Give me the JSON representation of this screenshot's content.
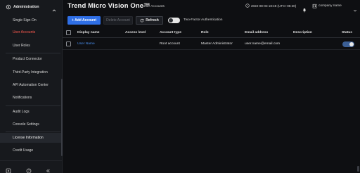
{
  "sidebar": {
    "header_label": "Administration",
    "items": [
      {
        "label": "Single Sign-On"
      },
      {
        "label": "User Accounts"
      },
      {
        "label": "User Roles"
      },
      {
        "label": "Product Connector"
      },
      {
        "label": "Third-Party Integration"
      },
      {
        "label": "API Automation Center"
      },
      {
        "label": "Notifications"
      },
      {
        "label": "Audit Logs"
      },
      {
        "label": "Console Settings"
      },
      {
        "label": "License Information"
      },
      {
        "label": "Credit Usage"
      }
    ]
  },
  "topbar": {
    "brand": "Trend Micro Vision One™",
    "breadcrumb": "User Accounts",
    "datetime": "2022-08-03 18:48 (UTC+05:20)",
    "account": "company name"
  },
  "toolbar": {
    "add_label": "+ Add Account",
    "delete_label": "Delete Account",
    "refresh_label": "Refresh",
    "two_factor_label": "Two-Factor Authentication"
  },
  "table": {
    "headers": [
      "Display name",
      "Access level",
      "Account type",
      "Role",
      "Email address",
      "Description",
      "Status"
    ],
    "rows": [
      {
        "display_name": "User Name",
        "access_level": "",
        "account_type": "Root account",
        "role": "Master Administrator",
        "email": "user.name@email.com",
        "description": "",
        "status": "enabled"
      }
    ]
  },
  "colors": {
    "accent": "#2f6fe6",
    "active_nav": "#ff5a4f",
    "link": "#4a90f0",
    "background": "#0e0f12"
  }
}
